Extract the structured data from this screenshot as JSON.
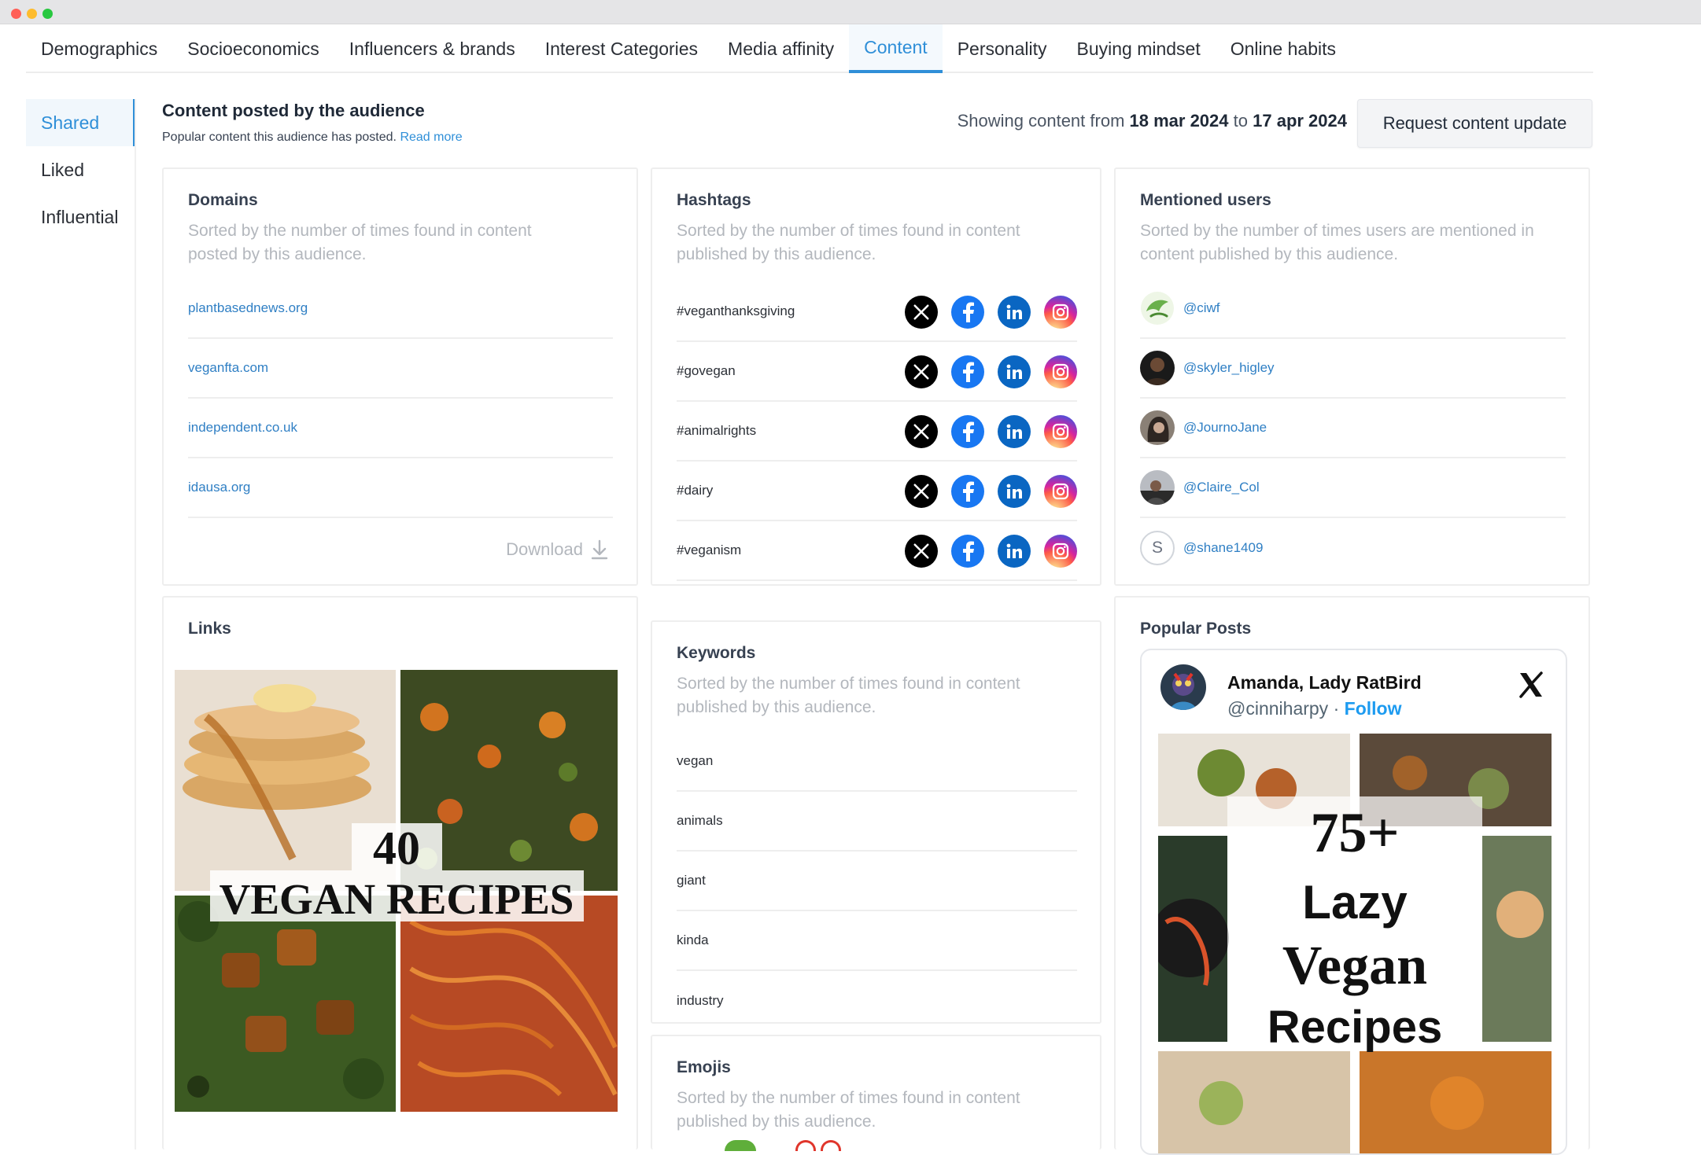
{
  "tabs": [
    {
      "label": "Demographics",
      "active": false
    },
    {
      "label": "Socioeconomics",
      "active": false
    },
    {
      "label": "Influencers & brands",
      "active": false
    },
    {
      "label": "Interest Categories",
      "active": false
    },
    {
      "label": "Media affinity",
      "active": false
    },
    {
      "label": "Content",
      "active": true
    },
    {
      "label": "Personality",
      "active": false
    },
    {
      "label": "Buying mindset",
      "active": false
    },
    {
      "label": "Online habits",
      "active": false
    }
  ],
  "sidebar": {
    "items": [
      {
        "label": "Shared",
        "active": true
      },
      {
        "label": "Liked",
        "active": false
      },
      {
        "label": "Influential",
        "active": false
      }
    ]
  },
  "header": {
    "title": "Content posted by the audience",
    "subtitle": "Popular content this audience has posted.",
    "read_more": "Read more",
    "date_prefix": "Showing content from",
    "date_from": "18 mar 2024",
    "date_to_word": "to",
    "date_to": "17 apr 2024",
    "request_button": "Request content update"
  },
  "domains": {
    "title": "Domains",
    "description": "Sorted by the number of times found in content posted by this audience.",
    "items": [
      "plantbasednews.org",
      "veganfta.com",
      "independent.co.uk",
      "idausa.org"
    ],
    "download_label": "Download"
  },
  "hashtags": {
    "title": "Hashtags",
    "description": "Sorted by the number of times found in content published by this audience.",
    "items": [
      "#veganthanksgiving",
      "#govegan",
      "#animalrights",
      "#dairy",
      "#veganism"
    ],
    "networks": [
      "x-icon",
      "facebook-icon",
      "linkedin-icon",
      "instagram-icon"
    ]
  },
  "mentions": {
    "title": "Mentioned users",
    "description": "Sorted by the number of times users are mentioned in content published by this audience.",
    "items": [
      {
        "handle": "@ciwf",
        "avatar": "logo"
      },
      {
        "handle": "@skyler_higley",
        "avatar": "photo"
      },
      {
        "handle": "@JournoJane",
        "avatar": "photo"
      },
      {
        "handle": "@Claire_Col",
        "avatar": "photo"
      },
      {
        "handle": "@shane1409",
        "avatar": "letter",
        "letter": "S"
      }
    ]
  },
  "links": {
    "title": "Links",
    "image_heading_number": "40",
    "image_heading_text": "VEGAN RECIPES"
  },
  "keywords": {
    "title": "Keywords",
    "description": "Sorted by the number of times found in content published by this audience.",
    "items": [
      "vegan",
      "animals",
      "giant",
      "kinda",
      "industry"
    ]
  },
  "emojis": {
    "title": "Emojis",
    "description": "Sorted by the number of times found in content published by this audience."
  },
  "popular_posts": {
    "title": "Popular Posts",
    "author_name": "Amanda, Lady RatBird",
    "author_handle": "@cinniharpy",
    "separator": "·",
    "follow_label": "Follow",
    "image_line1": "75+",
    "image_line2": "Lazy",
    "image_line3": "Vegan",
    "image_line4": "Recipes"
  },
  "colors": {
    "accent": "#2f8fd8",
    "link": "#2f7fc4",
    "muted": "#b3b7bd",
    "x_brand": "#000000",
    "facebook_brand": "#1877f2",
    "linkedin_brand": "#0a66c2"
  }
}
